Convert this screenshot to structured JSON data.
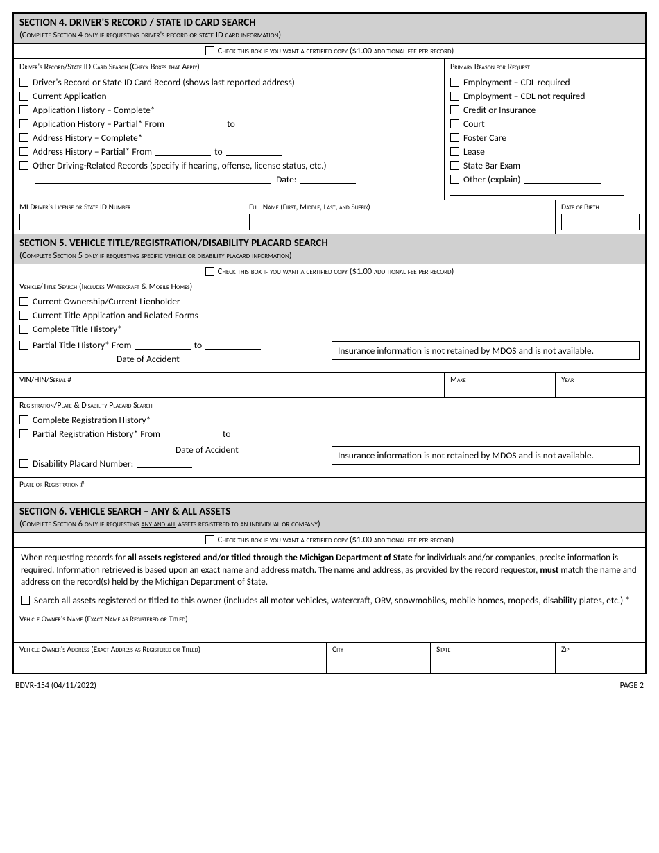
{
  "sections": {
    "s4": {
      "title": "SECTION 4. DRIVER'S RECORD / STATE ID CARD SEARCH",
      "sub_a": "(Complete Section 4",
      "sub_b": " only if requesting driver's record or state ID card information)",
      "cert": "Check this box if you want a certified copy ($1.00 additional fee per record)",
      "left_title": "Driver's Record/State ID Card Search (Check Boxes that Apply)",
      "right_title": "Primary Reason for Request",
      "left_items": {
        "i1": "Driver's Record or State ID Card Record (shows last reported address)",
        "i2": "Current Application",
        "i3": "Application History – Complete*",
        "i4a": "Application History – Partial* From",
        "i4b": "to",
        "i5": "Address History – Complete*",
        "i6a": "Address History – Partial* From",
        "i6b": "to",
        "i7": "Other Driving-Related Records (specify if hearing, offense, license status, etc.)",
        "date": "Date:"
      },
      "right_items": {
        "r1": "Employment – CDL required",
        "r2": "Employment – CDL not required",
        "r3": "Credit or Insurance",
        "r4": "Court",
        "r5": "Foster Care",
        "r6": "Lease",
        "r7": "State Bar Exam",
        "r8": "Other (explain)"
      },
      "fields": {
        "f1": "MI Driver's License or State ID Number",
        "f2": "Full Name (First, Middle, Last, and Suffix)",
        "f3": "Date of Birth"
      }
    },
    "s5": {
      "title": "SECTION 5. VEHICLE TITLE/REGISTRATION/DISABILITY PLACARD SEARCH",
      "sub_a": "(Complete Section 5",
      "sub_b": " only if requesting specific vehicle or disability placard information)",
      "cert": "Check this box if you want a certified copy ($1.00 additional fee per record)",
      "upper_title": "Vehicle/Title Search (Includes Watercraft & Mobile Homes)",
      "upper_items": {
        "u1": "Current Ownership/Current Lienholder",
        "u2": "Current Title Application and Related Forms",
        "u3": "Complete Title History*",
        "u4a": "Partial Title History*  From",
        "u4b": "to",
        "doa": "Date of Accident"
      },
      "note": "Insurance information is not retained by MDOS and is not available.",
      "fields1": {
        "f1": "VIN/HIN/Serial #",
        "f2": "Make",
        "f3": "Year"
      },
      "lower_title": "Registration/Plate & Disability Placard Search",
      "lower_items": {
        "l1": "Complete Registration History*",
        "l2a": "Partial Registration History*  From",
        "l2b": "to",
        "doa": "Date of Accident",
        "l3": "Disability Placard Number:"
      },
      "fields2": {
        "f1": "Plate or Registration #"
      }
    },
    "s6": {
      "title": "SECTION 6. VEHICLE SEARCH – ANY & ALL ASSETS",
      "sub_a": "(Complete Section 6",
      "sub_b": " only if requesting ",
      "sub_c": "any and all",
      "sub_d": " assets registered to an individual or company)",
      "cert": "Check this box if you want a certified copy ($1.00 additional fee per record)",
      "para_a": "When requesting records for ",
      "para_b": "all assets registered and/or titled through the Michigan Department of State",
      "para_c": " for individuals and/or companies, precise information is required. Information retrieved is based upon an ",
      "para_d": "exact name and address match",
      "para_e": ". The name and address, as provided by the record requestor, ",
      "para_f": "must",
      "para_g": " match the name and address on the record(s) held by the Michigan Department of State.",
      "check": "Search all assets registered or titled to this owner (includes all motor vehicles, watercraft, ORV, snowmobiles, mobile homes, mopeds, disability plates, etc.) *",
      "fields": {
        "f1": "Vehicle Owner's Name (Exact Name as Registered or Titled)",
        "f2": "Vehicle Owner's Address (Exact Address as Registered or Titled)",
        "f3": "City",
        "f4": "State",
        "f5": "Zip"
      }
    }
  },
  "footer": {
    "left": "BDVR-154 (04/11/2022)",
    "right": "PAGE 2"
  }
}
